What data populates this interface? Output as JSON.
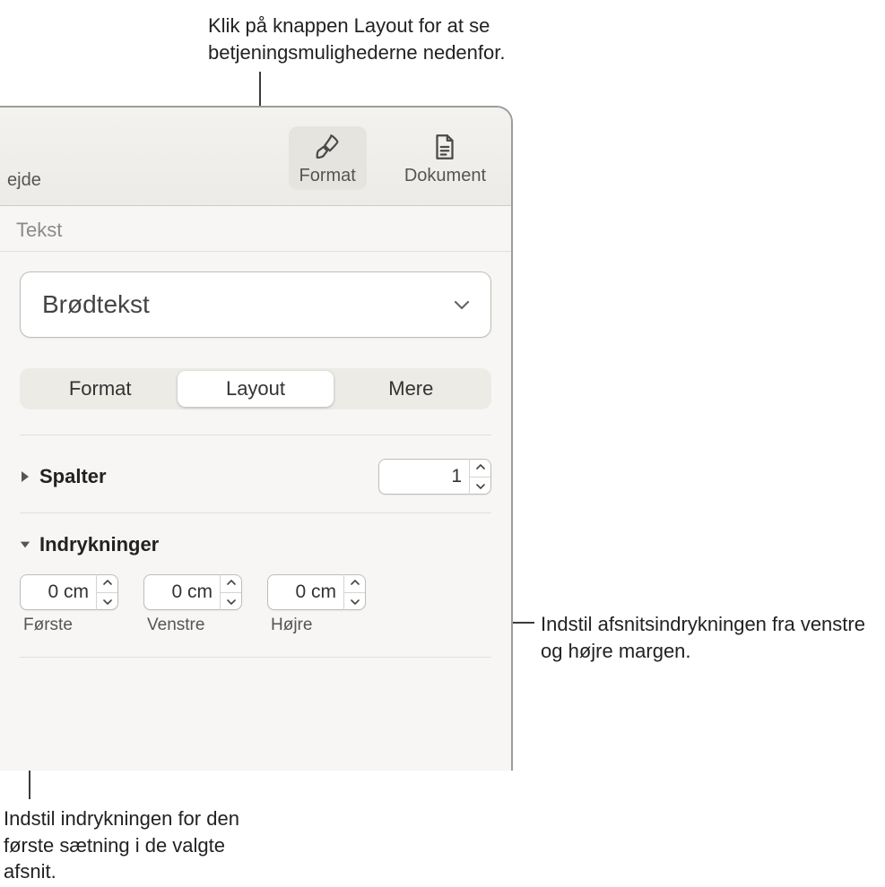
{
  "callouts": {
    "top": "Klik på knappen Layout for at se betjeningsmulighederne nedenfor.",
    "right": "Indstil afsnitsindrykningen fra venstre og højre margen.",
    "bottom": "Indstil indrykningen for den første sætning i de valgte afsnit."
  },
  "toolbar": {
    "leftFragment": "ejde",
    "format": "Format",
    "dokument": "Dokument"
  },
  "section": "Tekst",
  "styleSelect": "Brødtekst",
  "tabs": {
    "format": "Format",
    "layout": "Layout",
    "mere": "Mere"
  },
  "spalter": {
    "label": "Spalter",
    "value": "1"
  },
  "indents": {
    "label": "Indrykninger",
    "first": {
      "value": "0 cm",
      "label": "Første"
    },
    "left": {
      "value": "0 cm",
      "label": "Venstre"
    },
    "right": {
      "value": "0 cm",
      "label": "Højre"
    }
  }
}
